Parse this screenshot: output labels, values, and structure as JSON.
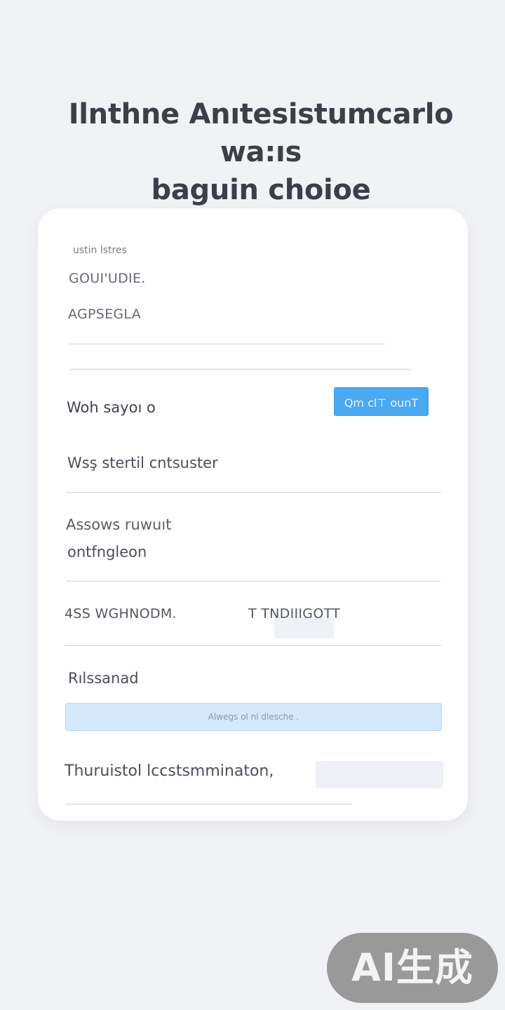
{
  "page": {
    "title_line1": "Ilnthne Anıtesistumcarlo wa:ıs",
    "title_line2": "baguin choioe"
  },
  "form": {
    "small_label": "ustin lstres",
    "field1": "GOUI'UDIE.",
    "field2": "AGPSEGLA"
  },
  "rows": {
    "row1_label": "Woh sayoı o",
    "row1_button": "Qm cl⊤ ounT",
    "row2_label": "Wsş stertil cntsuster",
    "row3_line1": "Assows ruwuıt",
    "row3_line2": "ontfngleon",
    "row4_left": "4SS WGHNODM.",
    "row4_right": "T TNDIIIGOTT",
    "row5_label": "Rılssanad",
    "search_value": "Alwegs ol nl dlesche .",
    "row6_label": "Thuruistol lccstsmminaton,"
  },
  "watermark": {
    "text": "AI生成"
  },
  "colors": {
    "background": "#f1f2f5",
    "card": "#ffffff",
    "accent_button": "#4aa9f0",
    "search_bg": "#d4e9fb",
    "field_box": "#eef1f5"
  }
}
